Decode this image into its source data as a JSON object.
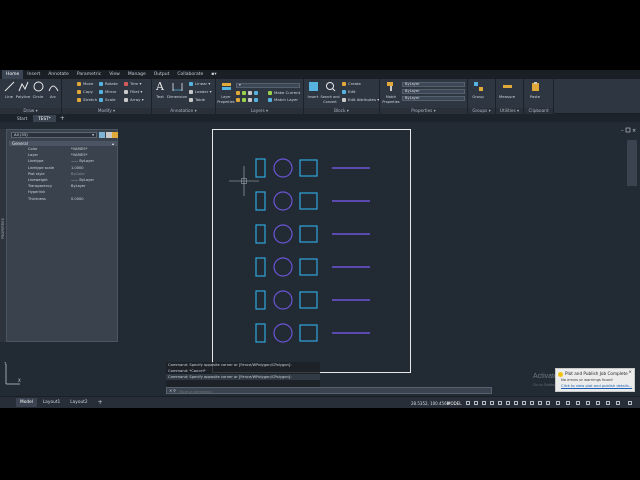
{
  "colors": {
    "accent_blue": "#2fa7df",
    "accent_purple": "#6c55d6",
    "paper_border": "#e8e8e8",
    "canvas_bg": "#222a33"
  },
  "ribbon": {
    "tabs": [
      "Home",
      "Insert",
      "Annotate",
      "Parametric",
      "View",
      "Manage",
      "Output",
      "Collaborate"
    ],
    "draw": {
      "title": "Draw ▾",
      "line": "Line",
      "polyline": "Polyline",
      "circle": "Circle",
      "arc": "Arc"
    },
    "modify": {
      "title": "Modify ▾",
      "move": "Move",
      "rotate": "Rotate",
      "trim": "Trim ▾",
      "copy": "Copy",
      "mirror": "Mirror",
      "fillet": "Fillet ▾",
      "stretch": "Stretch",
      "scale": "Scale",
      "array": "Array ▾"
    },
    "annotation": {
      "title": "Annotation ▾",
      "text": "Text",
      "dimension": "Dimension",
      "linear": "Linear ▾",
      "leader": "Leader ▾",
      "table": "Table"
    },
    "layers": {
      "title": "Layers ▾",
      "layer_properties": "Layer Properties",
      "make_current": "Make Current",
      "match_layer": "Match Layer"
    },
    "block": {
      "title": "Block ▾",
      "insert": "Insert",
      "create": "Create",
      "edit": "Edit",
      "edit_attributes": "Edit Attributes ▾"
    },
    "properties": {
      "title": "Properties ▾",
      "match_properties": "Match Properties",
      "bylayer_1": "ByLayer",
      "bylayer_2": "ByLayer",
      "bylayer_3": "ByLayer"
    },
    "groups": {
      "title": "Groups ▾",
      "group": "Group"
    },
    "utilities": {
      "title": "Utilities ▾",
      "measure": "Measure"
    },
    "clipboard": {
      "title": "Clipboard",
      "paste": "Paste"
    }
  },
  "file_tabs": [
    "Start",
    "TEST*"
  ],
  "props_palette": {
    "selection": "All (33)",
    "section": "General",
    "strip_label": "PROPERTIES",
    "rows": [
      {
        "key": "Color",
        "value": "*VARIES*"
      },
      {
        "key": "Layer",
        "value": "*VARIES*"
      },
      {
        "key": "Linetype",
        "value": "—— ByLayer"
      },
      {
        "key": "Linetype scale",
        "value": "1.0000"
      },
      {
        "key": "Plot style",
        "value": "ByColor"
      },
      {
        "key": "Lineweight",
        "value": "—— ByLayer"
      },
      {
        "key": "Transparency",
        "value": "ByLayer"
      },
      {
        "key": "Hyperlink",
        "value": ""
      },
      {
        "key": "Thickness",
        "value": "0.0000"
      }
    ]
  },
  "drawing": {
    "rows": 6
  },
  "command": {
    "history": [
      "Command: Specify opposite corner or [Fence/WPolygon/CPolygon]:",
      "Command: *Cancel*",
      "Command: Specify opposite corner or [Fence/WPolygon/CPolygon]:"
    ],
    "placeholder": "Type a command"
  },
  "statusbar": {
    "tabs": [
      "Model",
      "Layout1",
      "Layout2"
    ],
    "coords": "28.5352, 100.4560",
    "mode": "MODEL"
  },
  "notification": {
    "title": "Plot and Publish Job Complete",
    "message": "No errors or warnings found",
    "link": "Click to view plot and publish details..."
  },
  "watermark": {
    "title": "Activate Windows",
    "subtitle": "Go to Settings to activate Windows."
  }
}
